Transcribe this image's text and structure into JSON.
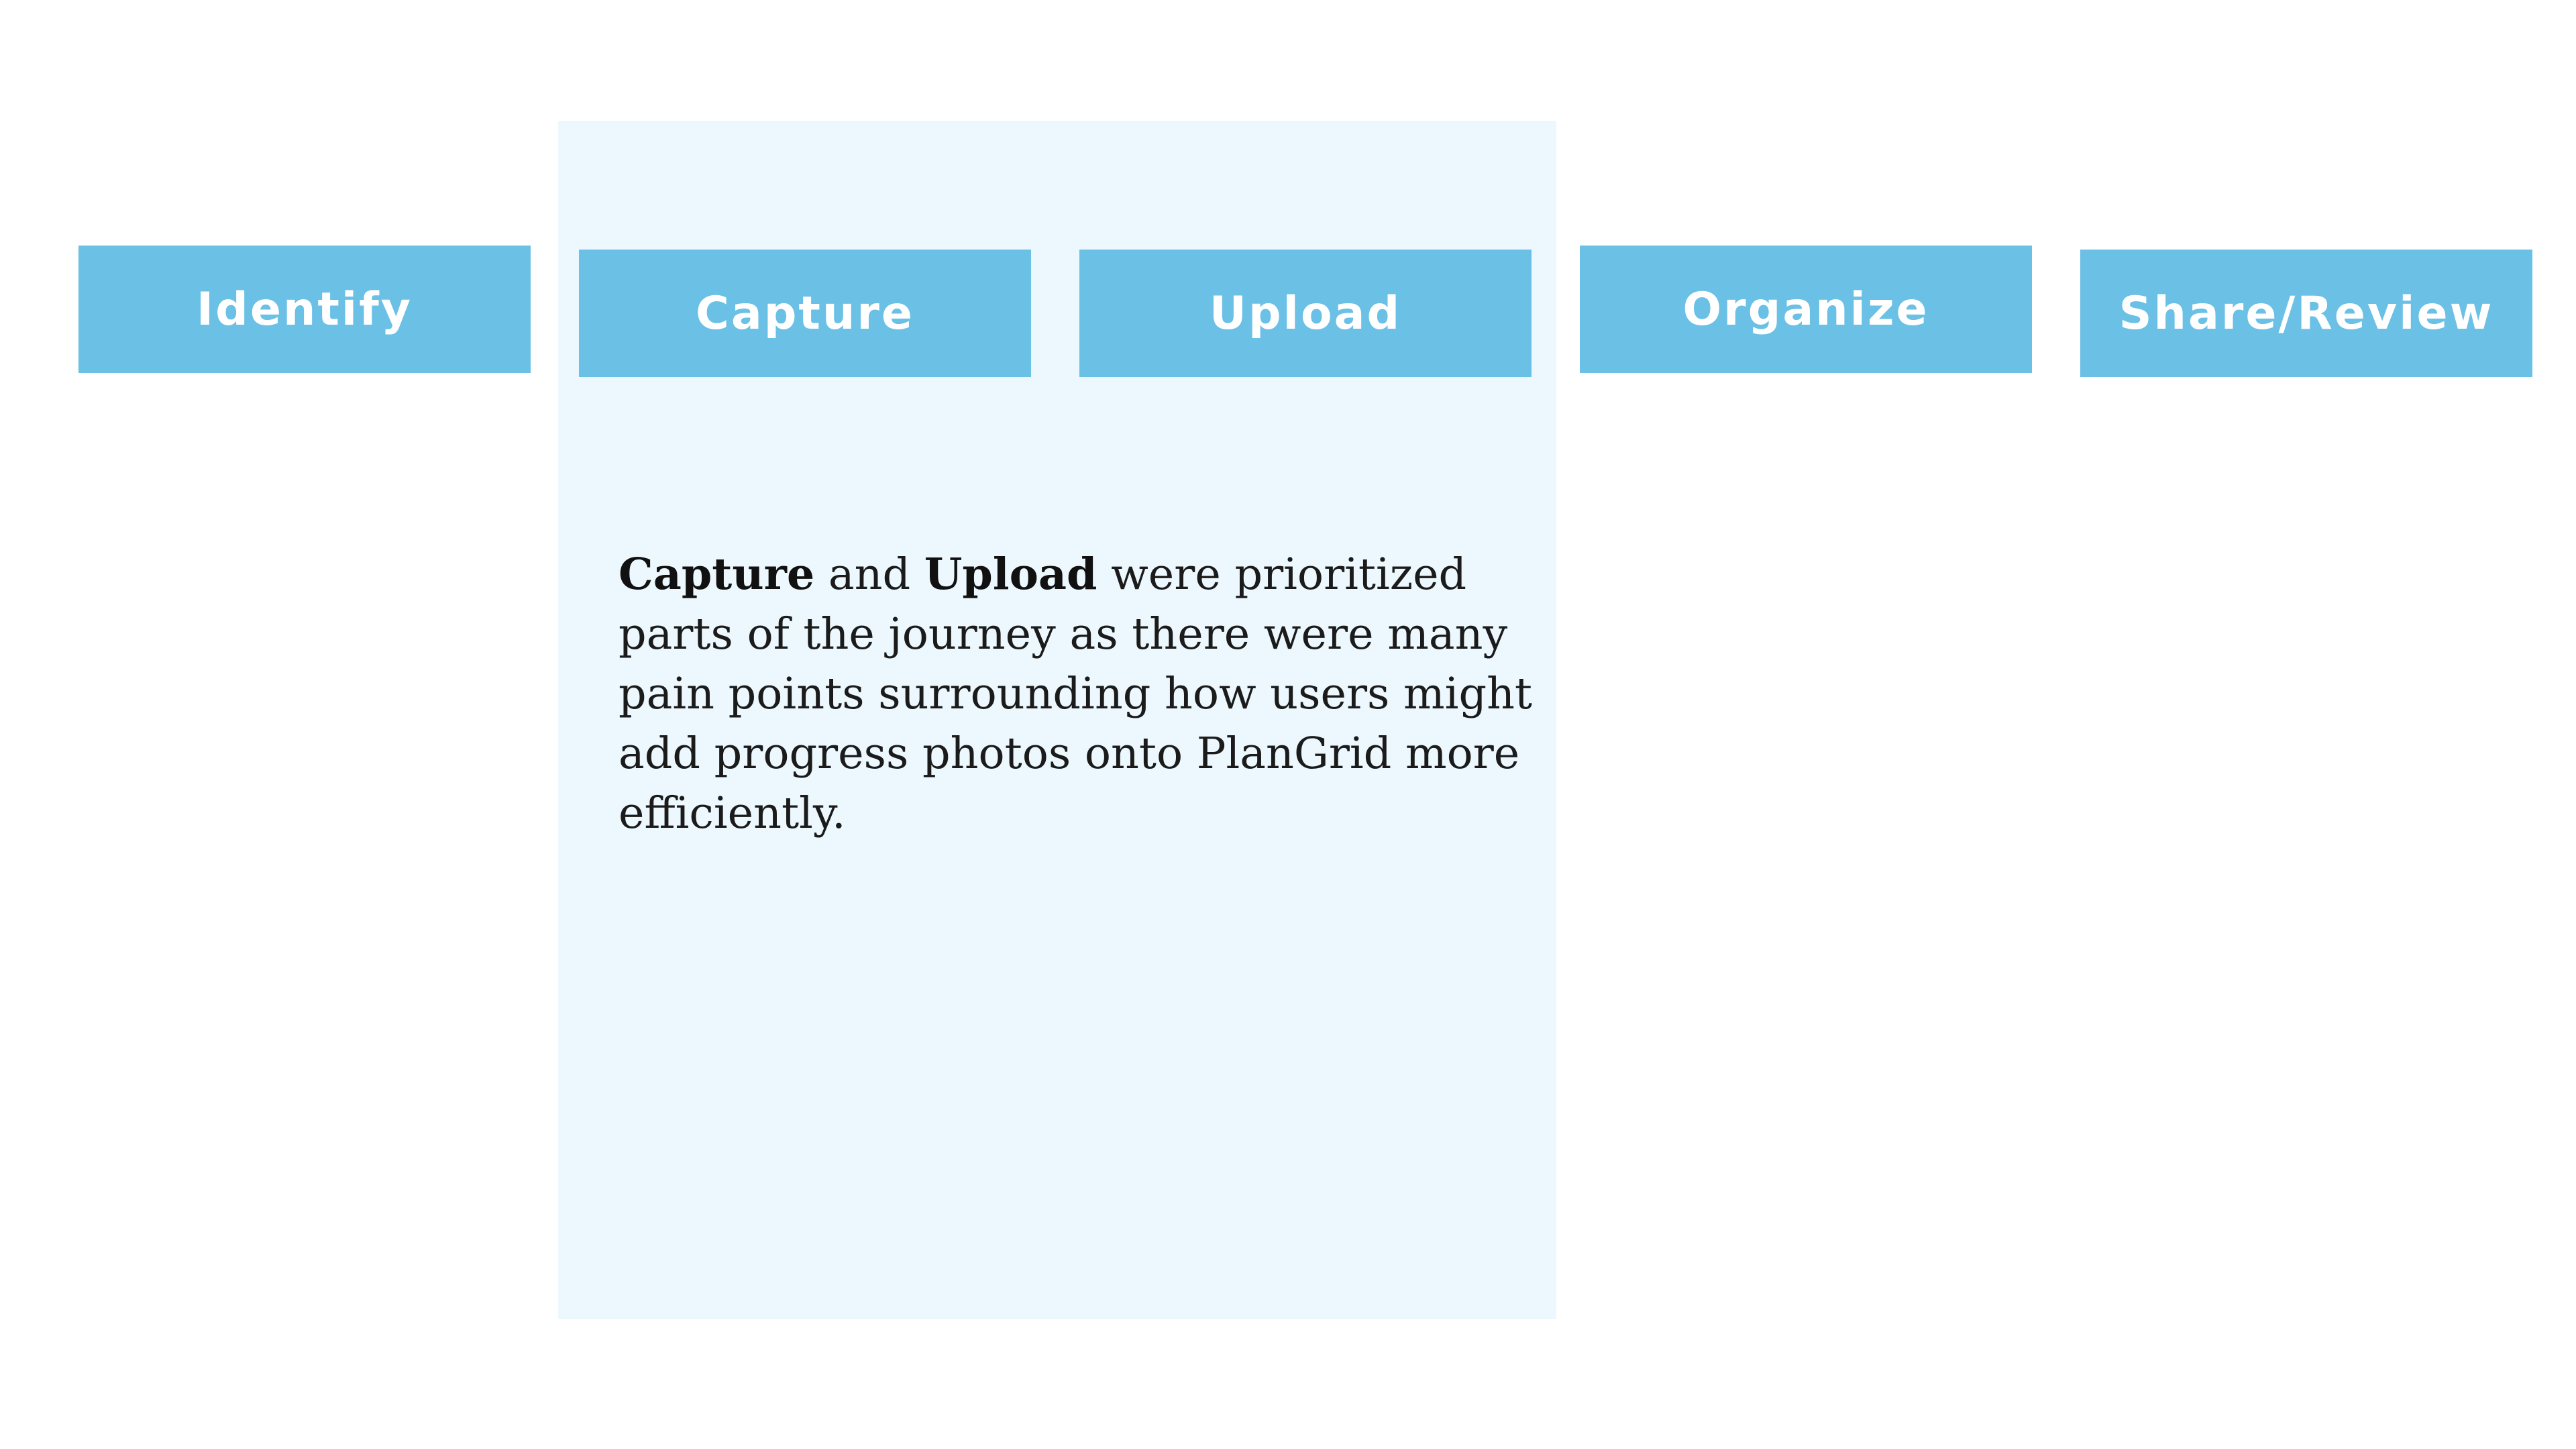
{
  "colors": {
    "stage_fill": "#6bc0e6",
    "stage_text": "#ffffff",
    "highlight_panel": "#ecf8fd",
    "body_text": "#1b1b1b"
  },
  "stages": [
    {
      "label": "Identify"
    },
    {
      "label": "Capture"
    },
    {
      "label": "Upload"
    },
    {
      "label": "Organize"
    },
    {
      "label": "Share/Review"
    }
  ],
  "note": {
    "bold_1": "Capture",
    "text_1": " and ",
    "bold_2": "Upload",
    "text_2": " were prioritized parts of the journey as there were many pain points surrounding how users might add progress photos onto PlanGrid more efficiently."
  }
}
